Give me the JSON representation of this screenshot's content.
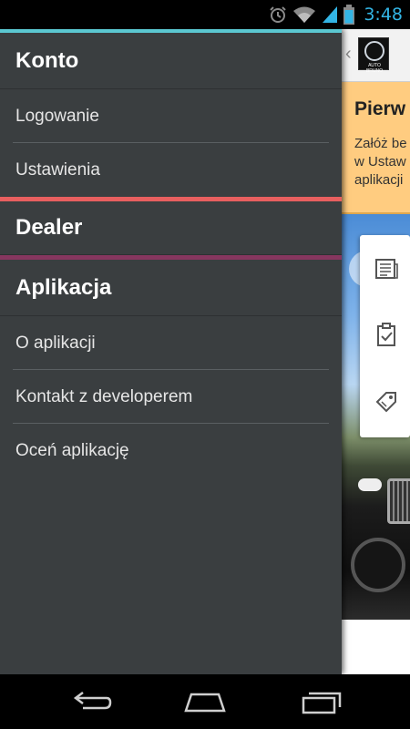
{
  "status_bar": {
    "time": "3:48",
    "icons": [
      "alarm-icon",
      "wifi-icon",
      "signal-icon",
      "battery-icon"
    ]
  },
  "app_behind": {
    "logo_text": "AUTO BRUNO",
    "banner": {
      "title": "Pierw",
      "text_line1": "Załóż be",
      "text_line2": "w Ustaw",
      "text_line3": "aplikacji"
    },
    "card_icons": [
      "news-icon",
      "clipboard-check-icon",
      "price-tag-icon"
    ]
  },
  "drawer": {
    "sections": [
      {
        "header": "Konto",
        "accent": "#5bc8d2",
        "items": [
          "Logowanie",
          "Ustawienia"
        ]
      },
      {
        "header": "Dealer",
        "accent": "#e85f5f",
        "items": []
      },
      {
        "header": "Aplikacja",
        "accent": "#86365f",
        "items": [
          "O aplikacji",
          "Kontakt z developerem",
          "Oceń aplikację"
        ]
      }
    ]
  },
  "nav_bar": {
    "buttons": [
      "back-icon",
      "home-icon",
      "recent-apps-icon"
    ]
  },
  "colors": {
    "drawer_bg": "#3a3e40",
    "status_time": "#33b5e5",
    "banner_bg": "#ffcc80"
  }
}
